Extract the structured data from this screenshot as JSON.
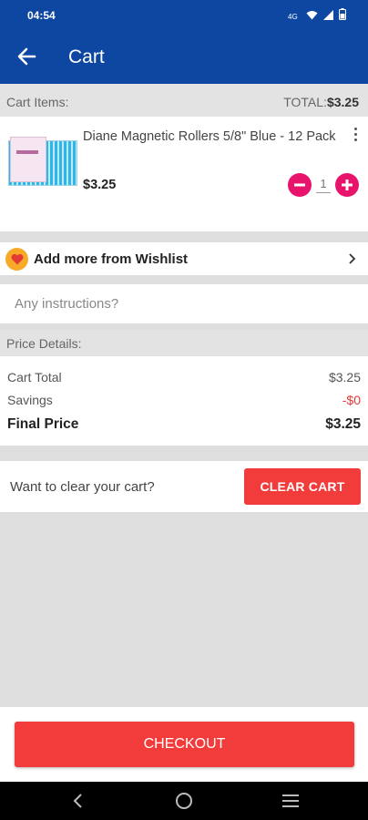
{
  "status": {
    "time": "04:54"
  },
  "header": {
    "title": "Cart"
  },
  "cart": {
    "items_label": "Cart Items:",
    "total_label": "TOTAL:",
    "total_value": "$3.25",
    "items": [
      {
        "name": "Diane Magnetic Rollers 5/8\" Blue - 12 Pack",
        "price": "$3.25",
        "quantity": "1"
      }
    ]
  },
  "wishlist": {
    "label": "Add more from Wishlist"
  },
  "instructions": {
    "placeholder": "Any instructions?"
  },
  "price_details": {
    "header": "Price Details:",
    "rows": [
      {
        "label": "Cart Total",
        "value": "$3.25"
      },
      {
        "label": "Savings",
        "value": "-$0"
      },
      {
        "label": "Final Price",
        "value": "$3.25"
      }
    ]
  },
  "clear": {
    "question": "Want to clear your cart?",
    "button": "CLEAR CART"
  },
  "checkout": {
    "button": "CHECKOUT"
  },
  "colors": {
    "app_bar": "#0d47a1",
    "accent_red": "#f23b3b",
    "qty_pink": "#e8136b",
    "savings_red": "#e53935"
  }
}
